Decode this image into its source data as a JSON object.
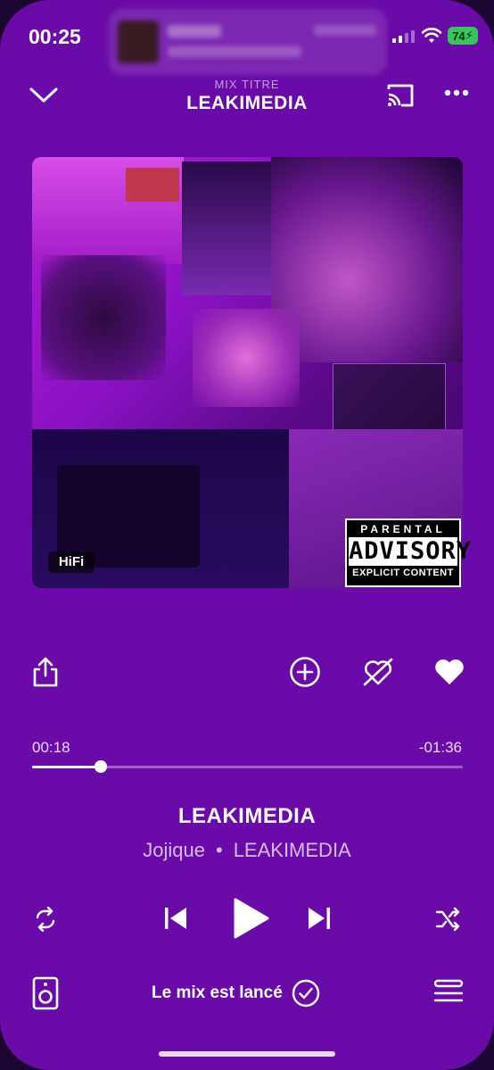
{
  "status_bar": {
    "time": "00:25",
    "battery": "74"
  },
  "header": {
    "subtitle": "MIX TITRE",
    "title": "LEAKIMEDIA"
  },
  "artwork": {
    "quality_badge": "HiFi",
    "advisory": {
      "line1": "PARENTAL",
      "line2": "ADVISORY",
      "line3": "EXPLICIT CONTENT"
    }
  },
  "actions": {
    "share": "share-icon",
    "add": "add-circle-icon",
    "dislike": "heart-slash-icon",
    "like": "heart-filled-icon"
  },
  "progress": {
    "elapsed": "00:18",
    "remaining": "-01:36",
    "fraction": 0.16
  },
  "track": {
    "title": "LEAKIMEDIA",
    "artist": "Jojique",
    "separator": "•",
    "album": "LEAKIMEDIA"
  },
  "controls": {
    "repeat": "repeat-icon",
    "previous": "previous-icon",
    "play": "play-icon",
    "next": "next-icon",
    "shuffle": "shuffle-icon"
  },
  "footer": {
    "mix_label": "Le mix est lancé"
  },
  "colors": {
    "background": "#6a0aa8",
    "accent": "#ffffff"
  }
}
